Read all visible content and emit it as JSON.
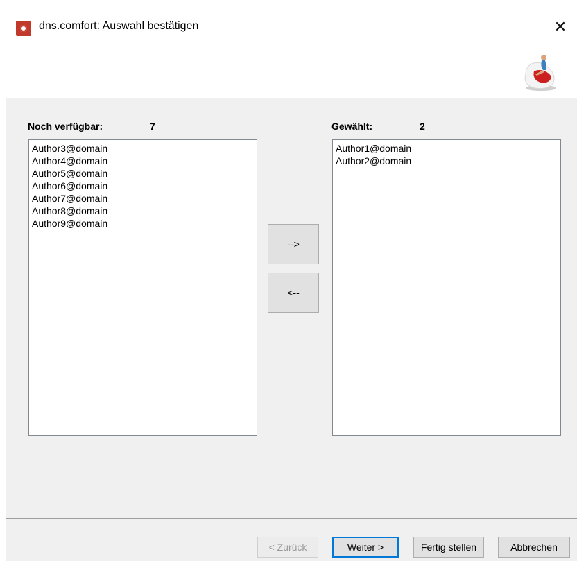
{
  "window": {
    "title": "dns.comfort: Auswahl bestätigen",
    "close_glyph": "✕",
    "app_icon": "gear-icon",
    "accent": "#c1392b",
    "border": "#2b6ec9"
  },
  "available": {
    "label": "Noch verfügbar:",
    "count": "7",
    "items": [
      "Author3@domain",
      "Author4@domain",
      "Author5@domain",
      "Author6@domain",
      "Author7@domain",
      "Author8@domain",
      "Author9@domain"
    ]
  },
  "selected": {
    "label": "Gewählt:",
    "count": "2",
    "items": [
      "Author1@domain",
      "Author2@domain"
    ]
  },
  "move": {
    "add_label": "-->",
    "remove_label": "<--"
  },
  "footer": {
    "back_label": "< Zurück",
    "next_label": "Weiter >",
    "finish_label": "Fertig stellen",
    "cancel_label": "Abbrechen"
  }
}
